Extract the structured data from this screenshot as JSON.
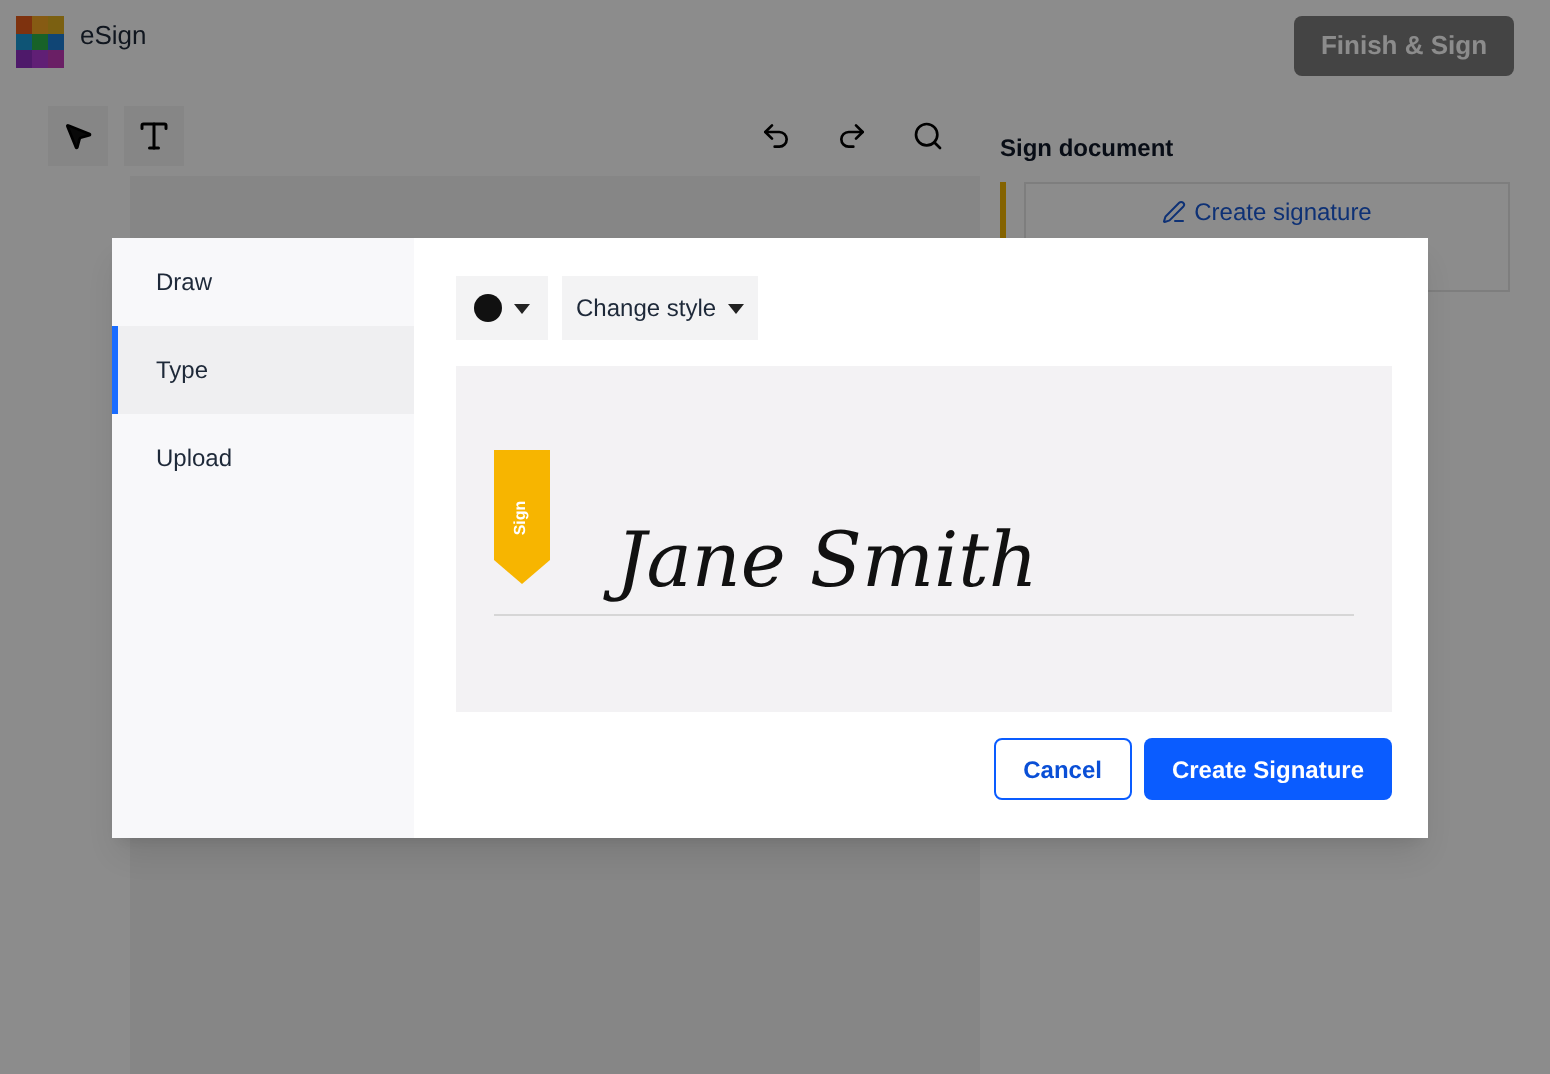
{
  "app": {
    "title": "eSign",
    "finish_button": "Finish & Sign"
  },
  "panel": {
    "title": "Sign document",
    "create_link": "Create signature"
  },
  "dialog": {
    "tabs": [
      {
        "label": "Draw",
        "selected": false
      },
      {
        "label": "Type",
        "selected": true
      },
      {
        "label": "Upload",
        "selected": false
      }
    ],
    "style_button": "Change style",
    "signature": {
      "tag": "Sign",
      "name": "Jane Smith"
    },
    "buttons": [
      {
        "label": "Cancel",
        "kind": "secondary"
      },
      {
        "label": "Create Signature",
        "kind": "primary"
      }
    ]
  }
}
